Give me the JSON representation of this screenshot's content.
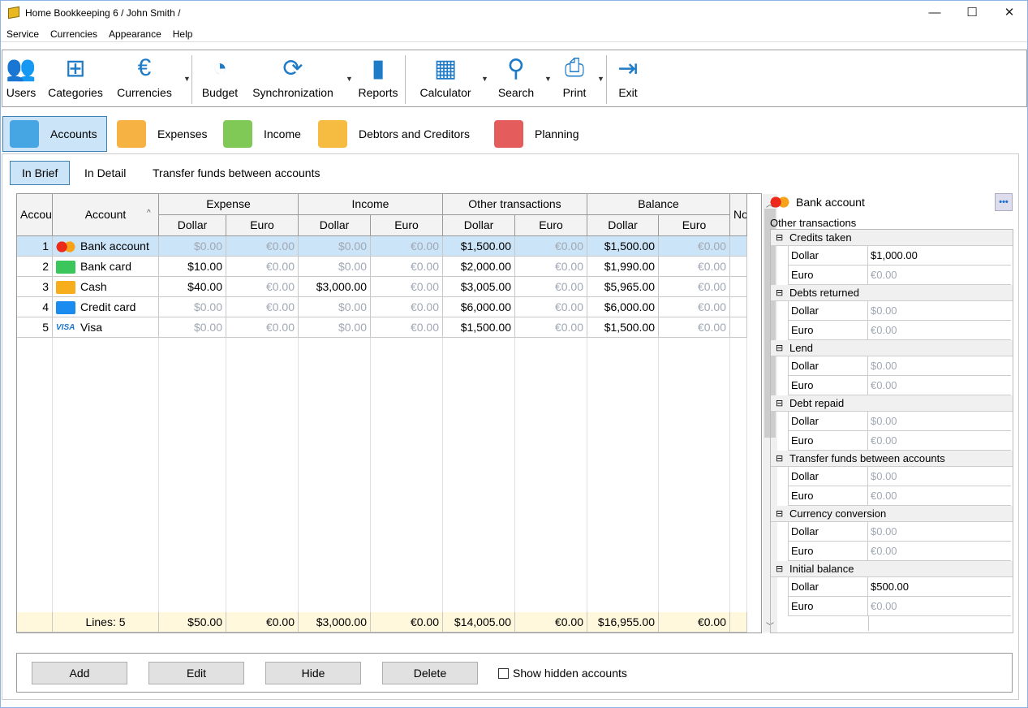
{
  "window": {
    "title": "Home Bookkeeping 6  / John Smith /",
    "minimize": "—",
    "maximize": "☐",
    "close": "✕"
  },
  "menu": [
    "Service",
    "Currencies",
    "Appearance",
    "Help"
  ],
  "toolbar": [
    {
      "label": "Users",
      "icon": "users-icon",
      "glyph": "👥"
    },
    {
      "label": "Categories",
      "icon": "categories-icon",
      "glyph": "⊞"
    },
    {
      "label": "Currencies",
      "icon": "euro-icon",
      "glyph": "€",
      "dropdown": true
    },
    {
      "label": "Budget",
      "icon": "gauge-icon",
      "glyph": "◔"
    },
    {
      "label": "Synchronization",
      "icon": "sync-icon",
      "glyph": "⟳",
      "dropdown": true
    },
    {
      "label": "Reports",
      "icon": "report-icon",
      "glyph": "▮"
    },
    {
      "label": "Calculator",
      "icon": "calculator-icon",
      "glyph": "▦",
      "dropdown": true
    },
    {
      "label": "Search",
      "icon": "search-icon",
      "glyph": "⚲",
      "dropdown": true
    },
    {
      "label": "Print",
      "icon": "printer-icon",
      "glyph": "⎙",
      "dropdown": true
    },
    {
      "label": "Exit",
      "icon": "exit-icon",
      "glyph": "⇥"
    }
  ],
  "nav_tabs": [
    {
      "label": "Accounts",
      "active": true
    },
    {
      "label": "Expenses"
    },
    {
      "label": "Income"
    },
    {
      "label": "Debtors and Creditors"
    },
    {
      "label": "Planning"
    }
  ],
  "sub_tabs": [
    {
      "label": "In Brief",
      "active": true
    },
    {
      "label": "In Detail"
    },
    {
      "label": "Transfer funds between accounts"
    }
  ],
  "grid": {
    "col_num": "Accou",
    "col_account": "Account",
    "col_no": "No",
    "groups": [
      "Expense",
      "Income",
      "Other transactions",
      "Balance"
    ],
    "currencies": [
      "Dollar",
      "Euro"
    ],
    "rows": [
      {
        "n": "1",
        "name": "Bank account",
        "icon": "mastercard-icon",
        "values": [
          "$0.00",
          "€0.00",
          "$0.00",
          "€0.00",
          "$1,500.00",
          "€0.00",
          "$1,500.00",
          "€0.00"
        ],
        "selected": true
      },
      {
        "n": "2",
        "name": "Bank card",
        "icon": "bank-card-icon",
        "values": [
          "$10.00",
          "€0.00",
          "$0.00",
          "€0.00",
          "$2,000.00",
          "€0.00",
          "$1,990.00",
          "€0.00"
        ]
      },
      {
        "n": "3",
        "name": "Cash",
        "icon": "wallet-icon",
        "values": [
          "$40.00",
          "€0.00",
          "$3,000.00",
          "€0.00",
          "$3,005.00",
          "€0.00",
          "$5,965.00",
          "€0.00"
        ]
      },
      {
        "n": "4",
        "name": "Credit card",
        "icon": "credit-card-icon",
        "values": [
          "$0.00",
          "€0.00",
          "$0.00",
          "€0.00",
          "$6,000.00",
          "€0.00",
          "$6,000.00",
          "€0.00"
        ]
      },
      {
        "n": "5",
        "name": "Visa",
        "icon": "visa-icon",
        "values": [
          "$0.00",
          "€0.00",
          "$0.00",
          "€0.00",
          "$1,500.00",
          "€0.00",
          "$1,500.00",
          "€0.00"
        ]
      }
    ],
    "footer": {
      "lines": "Lines: 5",
      "values": [
        "$50.00",
        "€0.00",
        "$3,000.00",
        "€0.00",
        "$14,005.00",
        "€0.00",
        "$16,955.00",
        "€0.00"
      ]
    }
  },
  "details": {
    "account": "Bank account",
    "more": "•••",
    "section": "Other transactions",
    "groups": [
      {
        "name": "Credits taken",
        "dollar": "$1,000.00",
        "euro": "€0.00"
      },
      {
        "name": "Debts returned",
        "dollar": "$0.00",
        "euro": "€0.00"
      },
      {
        "name": "Lend",
        "dollar": "$0.00",
        "euro": "€0.00"
      },
      {
        "name": "Debt repaid",
        "dollar": "$0.00",
        "euro": "€0.00"
      },
      {
        "name": "Transfer funds between accounts",
        "dollar": "$0.00",
        "euro": "€0.00"
      },
      {
        "name": "Currency conversion",
        "dollar": "$0.00",
        "euro": "€0.00"
      },
      {
        "name": "Initial balance",
        "dollar": "$500.00",
        "euro": "€0.00"
      }
    ],
    "dollar_label": "Dollar",
    "euro_label": "Euro"
  },
  "actions": {
    "add": "Add",
    "edit": "Edit",
    "hide": "Hide",
    "delete": "Delete",
    "show_hidden": "Show hidden accounts",
    "show_hidden_checked": false
  }
}
